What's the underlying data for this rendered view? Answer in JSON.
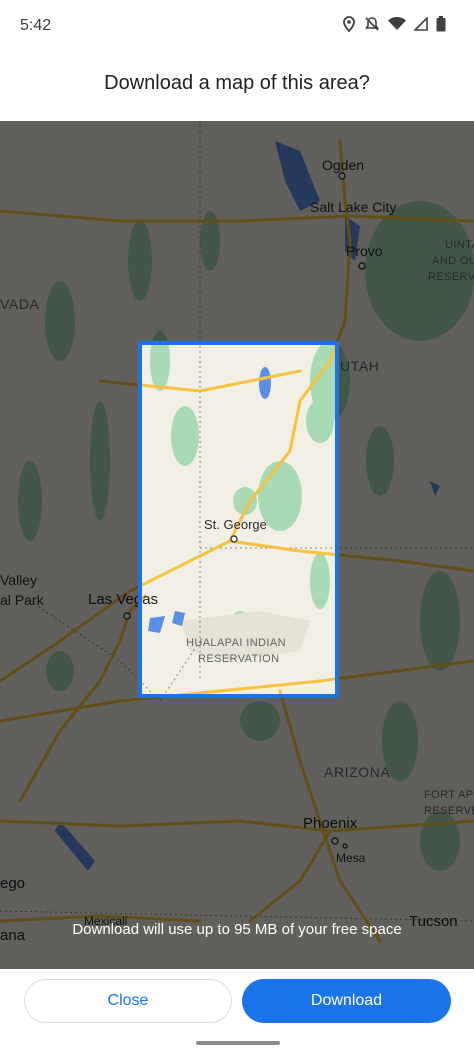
{
  "status_bar": {
    "time": "5:42",
    "icons": [
      "location-icon",
      "mute-icon",
      "wifi-icon",
      "signal-icon",
      "battery-icon"
    ]
  },
  "dialog": {
    "title": "Download a map of this area?",
    "info": "Download will use up to 95 MB of your free space"
  },
  "map": {
    "labels": {
      "ogden": "Ogden",
      "salt_lake_city": "Salt Lake City",
      "provo": "Provo",
      "uinta_1": "UINTA",
      "uinta_2": "AND OU",
      "uinta_3": "RESERVA",
      "nevada": "VADA",
      "utah": "UTAH",
      "st_george": "St. George",
      "valley_1": "Valley",
      "valley_2": "al Park",
      "las_vegas": "Las Vegas",
      "hualapai_1": "HUALAPAI INDIAN",
      "hualapai_2": "RESERVATION",
      "arizona": "ARIZONA",
      "fort_1": "FORT AP",
      "fort_2": "RESERVE",
      "phoenix": "Phoenix",
      "mesa": "Mesa",
      "ego": "ego",
      "ana": "ana",
      "mexicali": "Mexicali",
      "tucson": "Tucson"
    },
    "colors": {
      "land": "#f2efe5",
      "green": "#a8dab5",
      "water": "#5b8ee6",
      "highway": "#f9c23c",
      "selection": "#1a73e8"
    }
  },
  "actions": {
    "close_label": "Close",
    "download_label": "Download"
  }
}
